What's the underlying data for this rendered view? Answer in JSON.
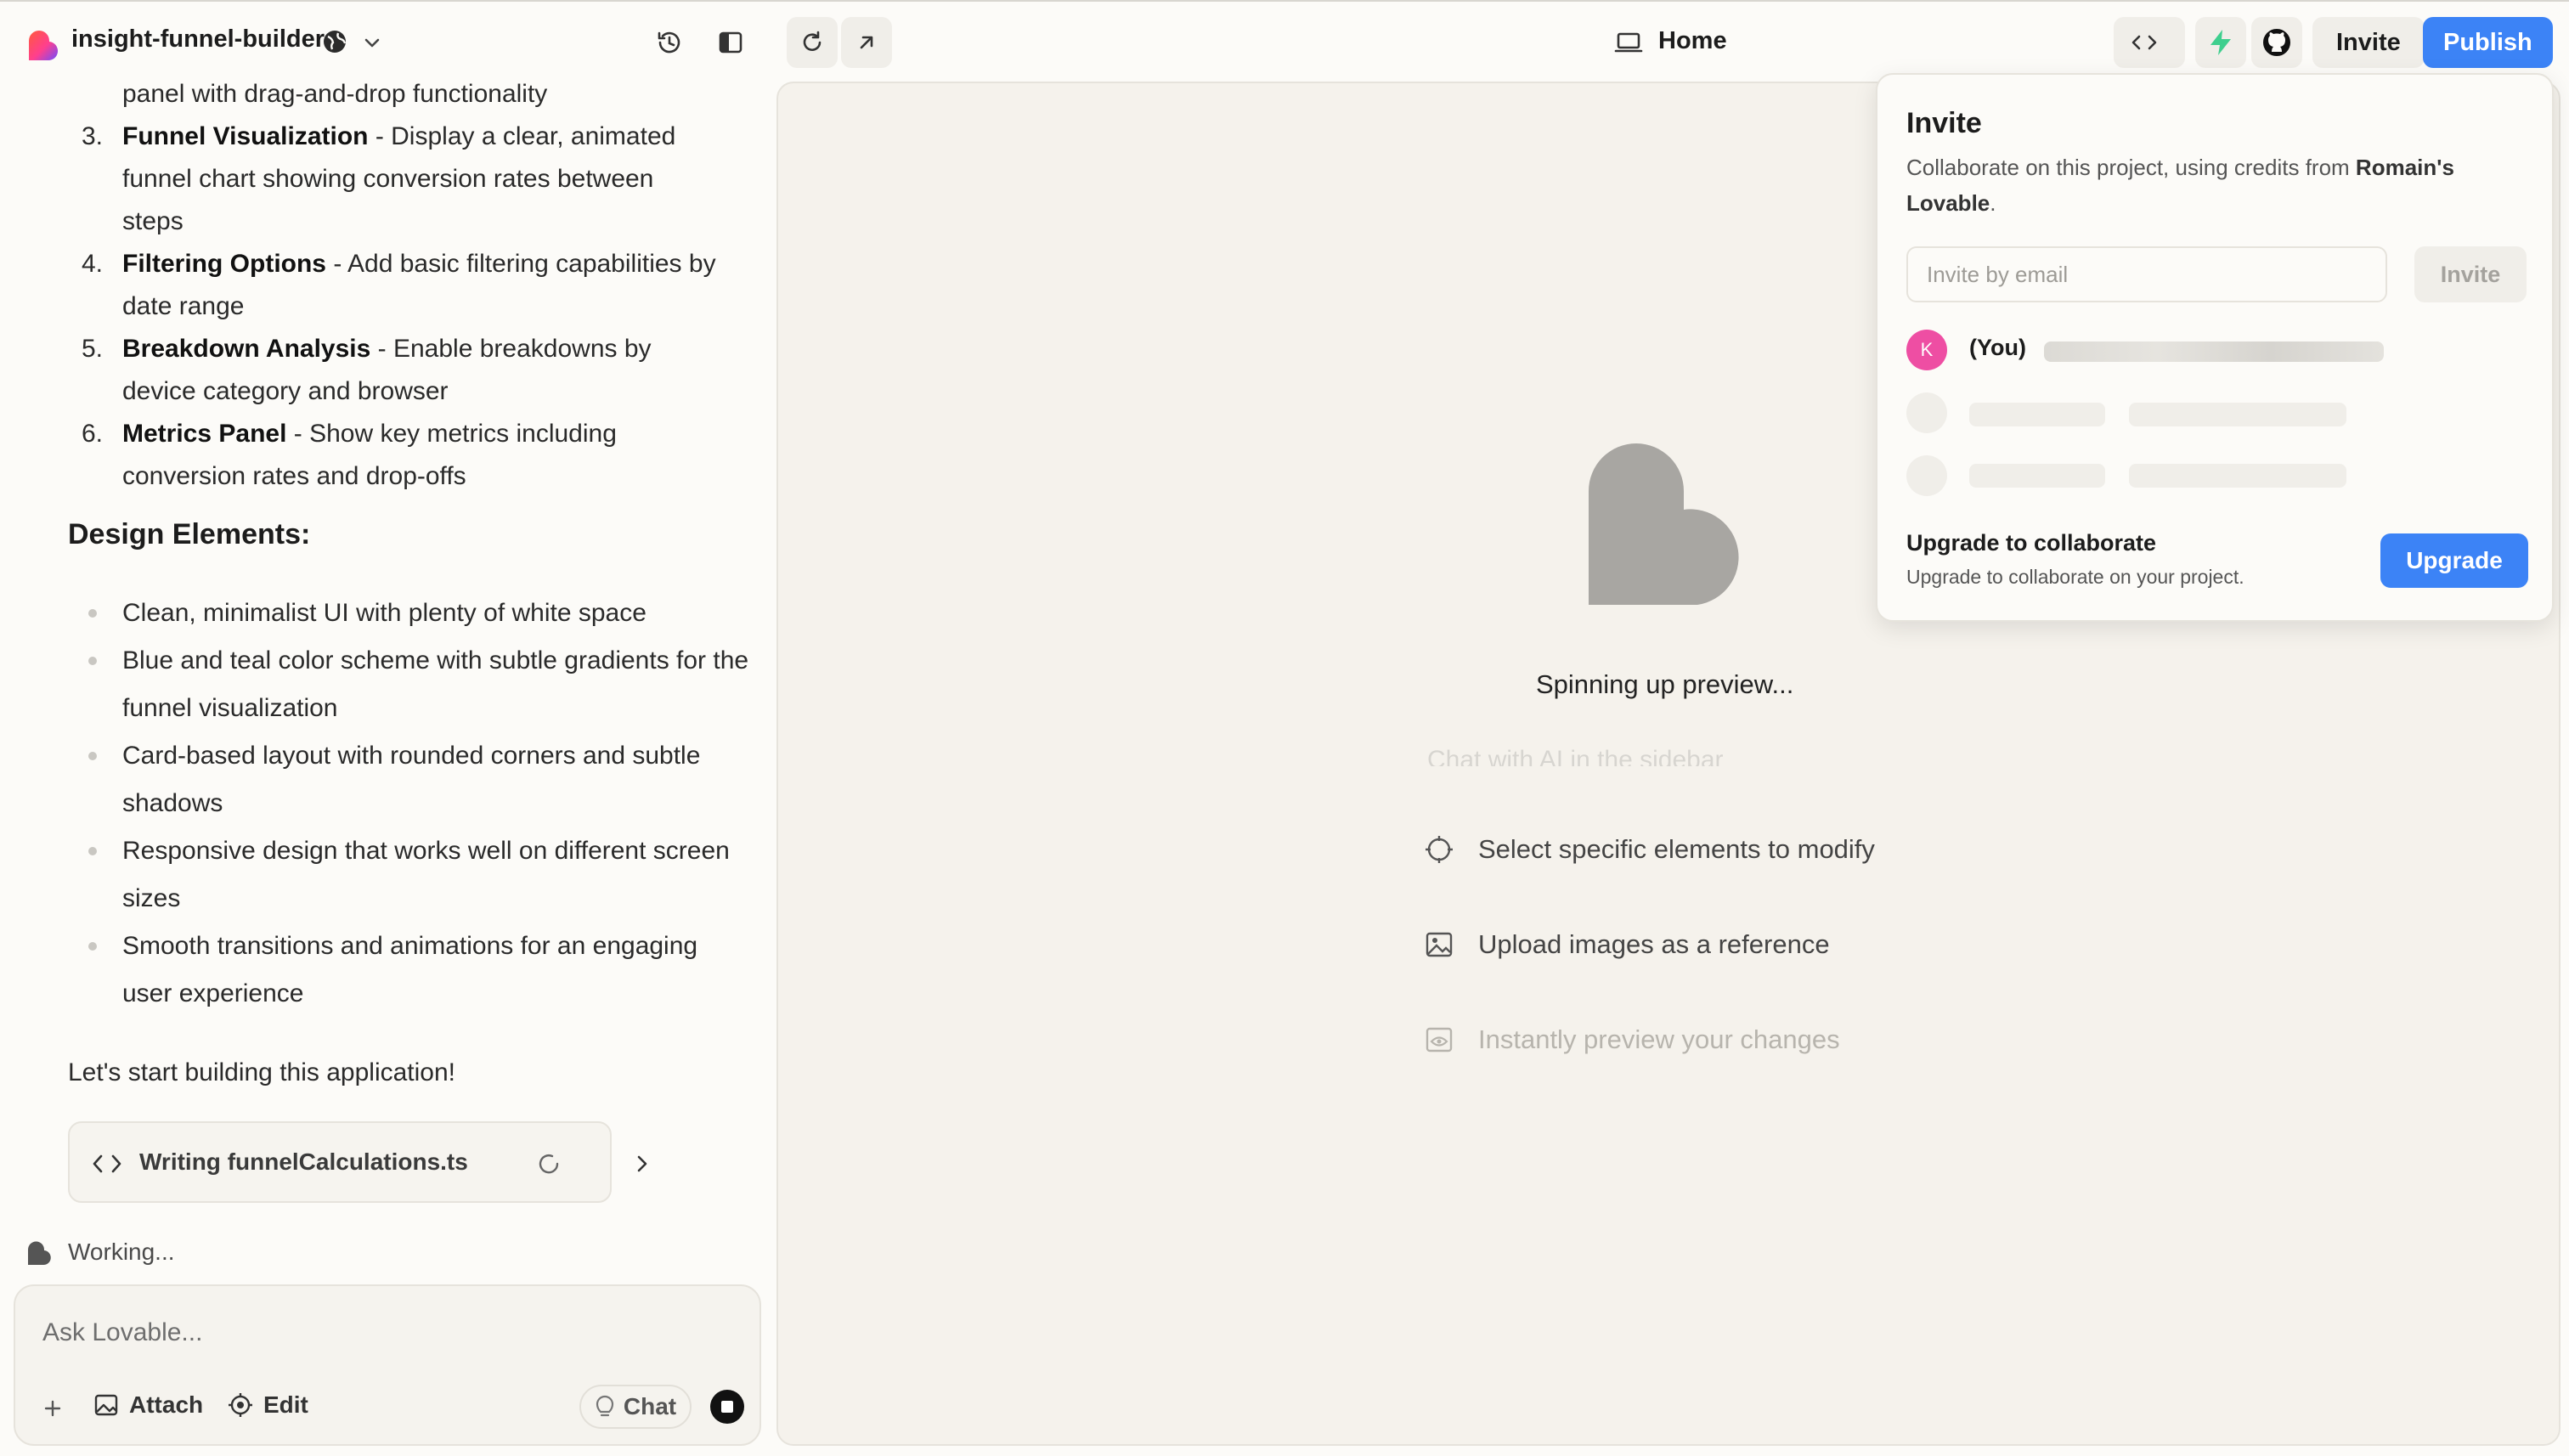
{
  "topbar": {
    "project_name": "insight-funnel-builder",
    "preview_route": "Home",
    "invite_label": "Invite",
    "publish_label": "Publish",
    "accent": "#3c83f6"
  },
  "chat": {
    "partial_line": "panel with drag-and-drop functionality",
    "features": [
      {
        "num": "3.",
        "title": "Funnel Visualization",
        "line1": " - Display a clear, animated",
        "line2": "funnel chart showing conversion rates between",
        "line3": "steps"
      },
      {
        "num": "4.",
        "title": "Filtering Options",
        "line1": " - Add basic filtering capabilities by",
        "line2": "date range"
      },
      {
        "num": "5.",
        "title": "Breakdown Analysis",
        "line1": " - Enable breakdowns by",
        "line2": "device category and browser"
      },
      {
        "num": "6.",
        "title": "Metrics Panel",
        "line1": " - Show key metrics including",
        "line2": "conversion rates and drop-offs"
      }
    ],
    "design_heading": "Design Elements:",
    "design_items": [
      "Clean, minimalist UI with plenty of white space",
      "Blue and teal color scheme with subtle gradients for the funnel visualization",
      "Card-based layout with rounded corners and subtle shadows",
      "Responsive design that works well on different screen sizes",
      "Smooth transitions and animations for an engaging user experience"
    ],
    "closing": "Let's start building this application!",
    "file_card": "Writing funnelCalculations.ts",
    "working": "Working..."
  },
  "composer": {
    "placeholder": "Ask Lovable...",
    "attach": "Attach",
    "edit": "Edit",
    "chat": "Chat"
  },
  "preview": {
    "status": "Spinning up preview...",
    "faded_tip": "Chat with AI in the sidebar",
    "tips": [
      "Select specific elements to modify",
      "Upload images as a reference",
      "Instantly preview your changes"
    ]
  },
  "invite_popup": {
    "title": "Invite",
    "desc_prefix": "Collaborate on this project, using credits from ",
    "workspace": "Romain's Lovable",
    "desc_suffix": ".",
    "email_placeholder": "Invite by email",
    "invite_button": "Invite",
    "avatar_initial": "K",
    "you_label": "(You)",
    "upgrade_title": "Upgrade to collaborate",
    "upgrade_sub": "Upgrade to collaborate on your project.",
    "upgrade_button": "Upgrade"
  }
}
